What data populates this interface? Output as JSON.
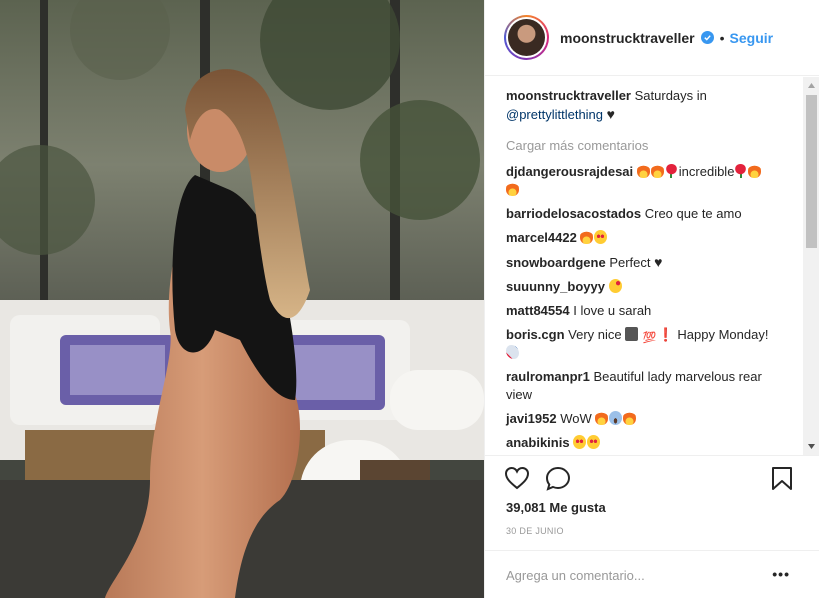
{
  "post": {
    "username": "moonstrucktraveller",
    "dot": "•",
    "follow_label": "Seguir"
  },
  "caption": {
    "username": "moonstrucktraveller",
    "text": "Saturdays in",
    "mention": "@prettylittlething"
  },
  "load_more": "Cargar más comentarios",
  "comments": [
    {
      "user": "djdangerousrajdesai",
      "text": "incredible"
    },
    {
      "user": "barriodelosacostados",
      "text": "Creo que te amo"
    },
    {
      "user": "marcel4422",
      "text": ""
    },
    {
      "user": "snowboardgene",
      "text": "Perfect"
    },
    {
      "user": "suuunny_boyyy",
      "text": ""
    },
    {
      "user": "matt84554",
      "text": "I love u sarah"
    },
    {
      "user": "boris.cgn",
      "text": "Very nice",
      "text2": "Happy Monday!"
    },
    {
      "user": "raulromanpr1",
      "text": "Beautiful lady marvelous rear view"
    },
    {
      "user": "javi1952",
      "text": "WoW"
    },
    {
      "user": "anabikinis",
      "text": ""
    }
  ],
  "icons": {
    "like": "heart-outline-icon",
    "comment": "comment-bubble-icon",
    "save": "bookmark-icon",
    "verified": "verified-badge-icon",
    "more": "more-options-icon"
  },
  "likes_text": "39,081 Me gusta",
  "date_text": "30 DE JUNIO",
  "add_comment_placeholder": "Agrega un comentario...",
  "more_label": "•••",
  "colors": {
    "accent": "#3897f0",
    "text": "#262626",
    "muted": "#999999",
    "border": "#efefef"
  }
}
